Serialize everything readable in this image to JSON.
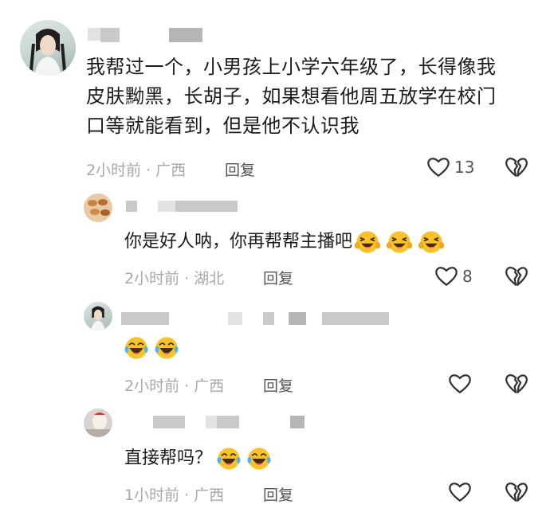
{
  "comments": [
    {
      "text_lines": [
        "我帮过一个，小男孩上小学六年级了，长得像我",
        "皮肤黝黑，长胡子，如果想看他周五放学在校门",
        "口等就能看到，但是他不认识我"
      ],
      "time": "2小时前",
      "separator": "·",
      "location": "广西",
      "reply_label": "回复",
      "likes": "13"
    },
    {
      "text": "你是好人呐，你再帮帮主播吧",
      "emoji_count": 3,
      "emoji_icon": "laughing-squint-emoji",
      "time": "2小时前",
      "separator": "·",
      "location": "湖北",
      "reply_label": "回复",
      "likes": "8"
    },
    {
      "emoji_count": 2,
      "emoji_icon": "tears-of-joy-emoji",
      "time": "2小时前",
      "separator": "·",
      "location": "广西",
      "reply_label": "回复",
      "likes": ""
    },
    {
      "text": "直接帮吗？",
      "emoji_count": 2,
      "emoji_icon": "tears-of-joy-emoji",
      "time": "1小时前",
      "separator": "·",
      "location": "广西",
      "reply_label": "回复",
      "likes": ""
    }
  ],
  "icons": {
    "like": "heart-outline-icon",
    "dislike": "broken-heart-icon"
  },
  "colors": {
    "meta_text": "#a8a8a8",
    "icon_stroke": "#333333",
    "emoji_face": "#f6c32b"
  }
}
